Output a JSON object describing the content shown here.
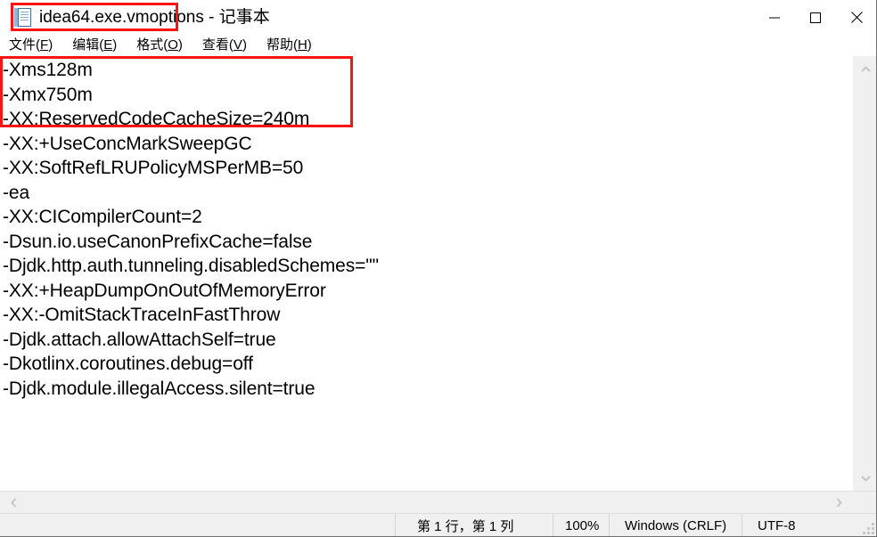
{
  "window": {
    "titlebar": {
      "icon": "notepad-icon",
      "file_name": "idea64.exe.vmoptions",
      "separator": " - ",
      "app_name": "记事本",
      "full_title": "idea64.exe.vmoptions - 记事本"
    },
    "controls": [
      {
        "name": "minimize-button",
        "glyph": "minimize-icon"
      },
      {
        "name": "maximize-button",
        "glyph": "maximize-icon"
      },
      {
        "name": "close-button",
        "glyph": "close-icon"
      }
    ]
  },
  "menubar": {
    "items": [
      {
        "name": "menu-file",
        "label": "文件",
        "accel": "F"
      },
      {
        "name": "menu-edit",
        "label": "编辑",
        "accel": "E"
      },
      {
        "name": "menu-format",
        "label": "格式",
        "accel": "O"
      },
      {
        "name": "menu-view",
        "label": "查看",
        "accel": "V"
      },
      {
        "name": "menu-help",
        "label": "帮助",
        "accel": "H"
      }
    ]
  },
  "editor": {
    "lines": [
      "-Xms128m",
      "-Xmx750m",
      "-XX:ReservedCodeCacheSize=240m",
      "-XX:+UseConcMarkSweepGC",
      "-XX:SoftRefLRUPolicyMSPerMB=50",
      "-ea",
      "-XX:CICompilerCount=2",
      "-Dsun.io.useCanonPrefixCache=false",
      "-Djdk.http.auth.tunneling.disabledSchemes=\"\"",
      "-XX:+HeapDumpOnOutOfMemoryError",
      "-XX:-OmitStackTraceInFastThrow",
      "-Djdk.attach.allowAttachSelf=true",
      "-Dkotlinx.coroutines.debug=off",
      "-Djdk.module.illegalAccess.silent=true"
    ]
  },
  "scrollbars": {
    "vertical": {
      "up_arrow": "chevron-up-icon",
      "down_arrow": "chevron-down-icon"
    },
    "horizontal": {
      "left_arrow": "chevron-left-icon",
      "right_arrow": "chevron-right-icon"
    }
  },
  "statusbar": {
    "line_col": "第 1 行，第 1 列",
    "zoom": "100%",
    "line_ending": "Windows (CRLF)",
    "encoding": "UTF-8",
    "resize_grip": "resize-grip-icon"
  },
  "annotations": {
    "highlight_color": "#fa1414",
    "boxes": [
      {
        "name": "annotation-box-title",
        "target": "idea64.exe.vmoptions"
      },
      {
        "name": "annotation-box-memory-options",
        "target": "-Xms128m / -Xmx750m / -XX:ReservedCodeCacheSize=240m"
      }
    ]
  }
}
